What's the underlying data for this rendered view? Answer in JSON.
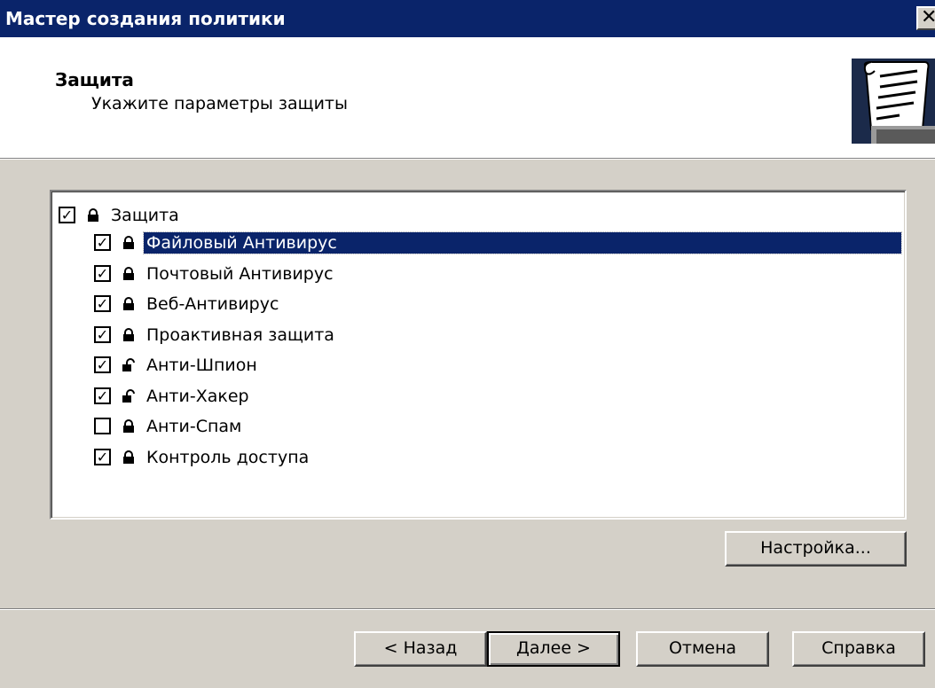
{
  "window": {
    "title": "Мастер создания политики",
    "close_glyph": "✕"
  },
  "header": {
    "title": "Защита",
    "subtitle": "Укажите параметры защиты",
    "icon": "scroll-document-icon"
  },
  "tree": {
    "root": {
      "label": "Защита",
      "checked": true,
      "locked": true
    },
    "items": [
      {
        "label": "Файловый Антивирус",
        "checked": true,
        "locked": true,
        "selected": true
      },
      {
        "label": "Почтовый Антивирус",
        "checked": true,
        "locked": true,
        "selected": false
      },
      {
        "label": "Веб-Антивирус",
        "checked": true,
        "locked": true,
        "selected": false
      },
      {
        "label": "Проактивная защита",
        "checked": true,
        "locked": true,
        "selected": false
      },
      {
        "label": "Анти-Шпион",
        "checked": true,
        "locked": false,
        "selected": false
      },
      {
        "label": "Анти-Хакер",
        "checked": true,
        "locked": false,
        "selected": false
      },
      {
        "label": "Анти-Спам",
        "checked": false,
        "locked": true,
        "selected": false
      },
      {
        "label": "Контроль доступа",
        "checked": true,
        "locked": true,
        "selected": false
      }
    ]
  },
  "buttons": {
    "settings": "Настройка...",
    "back": "< Назад",
    "next": "Далее >",
    "cancel": "Отмена",
    "help": "Справка"
  },
  "colors": {
    "titlebar": "#0a246a",
    "selection": "#0a246a",
    "face": "#d4d0c8"
  }
}
